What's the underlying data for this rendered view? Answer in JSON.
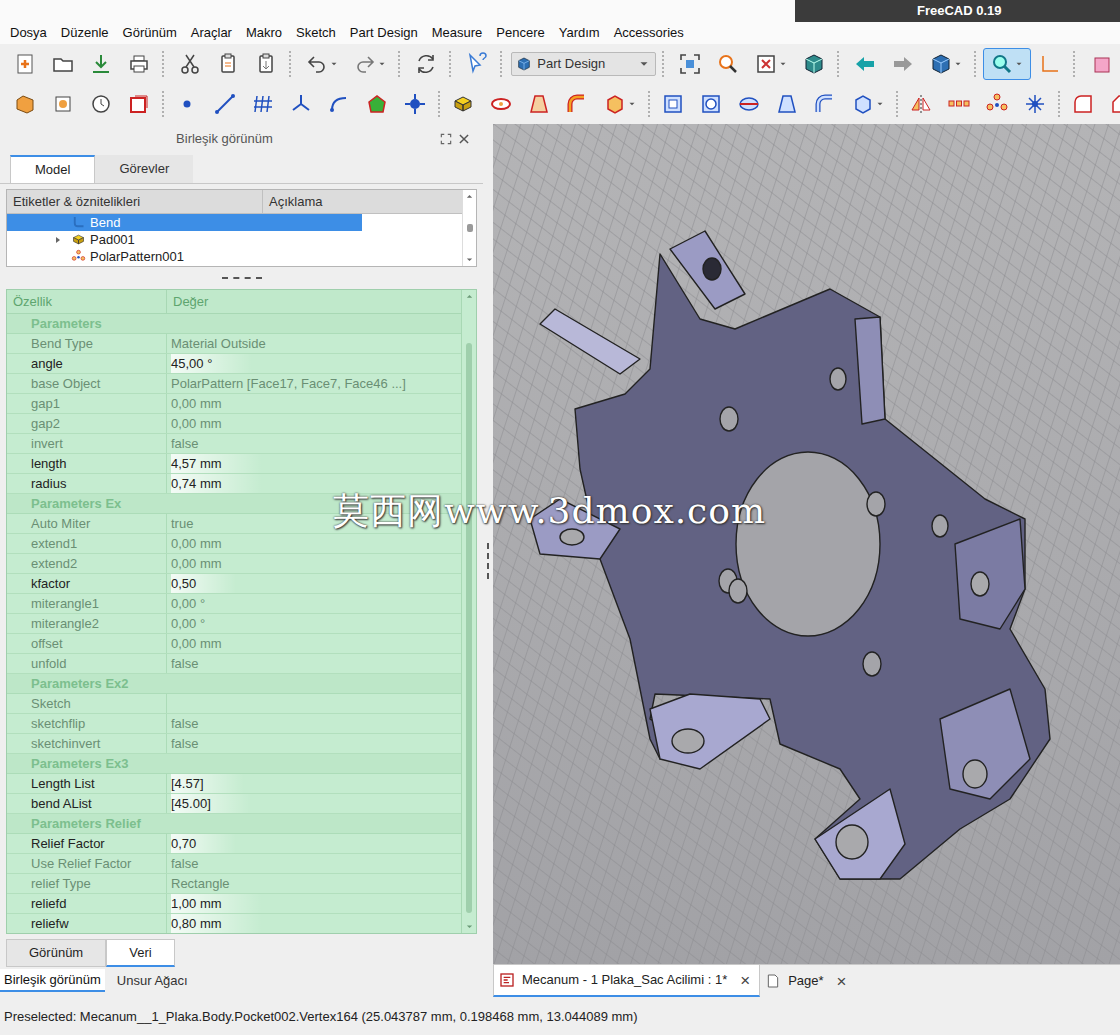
{
  "window": {
    "title": "FreeCAD 0.19"
  },
  "menu": [
    "Dosya",
    "Düzenle",
    "Görünüm",
    "Araçlar",
    "Makro",
    "Sketch",
    "Part Design",
    "Measure",
    "Pencere",
    "Yardım",
    "Accessories"
  ],
  "workbench": "Part Design",
  "combo_view": {
    "title": "Birleşik görünüm",
    "tabs": [
      {
        "label": "Model",
        "selected": true
      },
      {
        "label": "Görevler",
        "selected": false
      }
    ]
  },
  "tree": {
    "columns": [
      "Etiketler & öznitelikleri",
      "Açıklama"
    ],
    "items": [
      {
        "label": "Bend",
        "kind": "bend",
        "selected": true,
        "expandable": false
      },
      {
        "label": "Pad001",
        "kind": "pad",
        "selected": false,
        "expandable": true
      },
      {
        "label": "PolarPattern001",
        "kind": "pattern",
        "selected": false,
        "expandable": false
      }
    ]
  },
  "properties": {
    "columns": [
      "Özellik",
      "Değer"
    ],
    "groups": [
      {
        "title": "Parameters",
        "rows": [
          {
            "name": "Bend Type",
            "value": "Material Outside",
            "highlighted": false
          },
          {
            "name": "angle",
            "value": "45,00 °",
            "highlighted": true
          },
          {
            "name": "base Object",
            "value": "PolarPattern [Face17, Face7, Face46 ...]",
            "highlighted": false
          },
          {
            "name": "gap1",
            "value": "0,00 mm",
            "highlighted": false
          },
          {
            "name": "gap2",
            "value": "0,00 mm",
            "highlighted": false
          },
          {
            "name": "invert",
            "value": "false",
            "highlighted": false
          },
          {
            "name": "length",
            "value": "4,57 mm",
            "highlighted": true
          },
          {
            "name": "radius",
            "value": "0,74 mm",
            "highlighted": true
          }
        ]
      },
      {
        "title": "Parameters Ex",
        "rows": [
          {
            "name": "Auto Miter",
            "value": "true",
            "highlighted": false
          },
          {
            "name": "extend1",
            "value": "0,00 mm",
            "highlighted": false
          },
          {
            "name": "extend2",
            "value": "0,00 mm",
            "highlighted": false
          },
          {
            "name": "kfactor",
            "value": "0,50",
            "highlighted": true
          },
          {
            "name": "miterangle1",
            "value": "0,00 °",
            "highlighted": false
          },
          {
            "name": "miterangle2",
            "value": "0,00 °",
            "highlighted": false
          },
          {
            "name": "offset",
            "value": "0,00 mm",
            "highlighted": false
          },
          {
            "name": "unfold",
            "value": "false",
            "highlighted": false
          }
        ]
      },
      {
        "title": "Parameters Ex2",
        "rows": [
          {
            "name": "Sketch",
            "value": "",
            "highlighted": false
          },
          {
            "name": "sketchflip",
            "value": "false",
            "highlighted": false
          },
          {
            "name": "sketchinvert",
            "value": "false",
            "highlighted": false
          }
        ]
      },
      {
        "title": "Parameters Ex3",
        "rows": [
          {
            "name": "Length List",
            "value": "[4.57]",
            "highlighted": true
          },
          {
            "name": "bend AList",
            "value": "[45.00]",
            "highlighted": true
          }
        ]
      },
      {
        "title": "Parameters Relief",
        "rows": [
          {
            "name": "Relief Factor",
            "value": "0,70",
            "highlighted": true
          },
          {
            "name": "Use Relief Factor",
            "value": "false",
            "highlighted": false
          },
          {
            "name": "relief Type",
            "value": "Rectangle",
            "highlighted": false
          },
          {
            "name": "reliefd",
            "value": "1,00 mm",
            "highlighted": true
          },
          {
            "name": "reliefw",
            "value": "0,80 mm",
            "highlighted": true
          }
        ]
      }
    ]
  },
  "property_tabs": [
    {
      "label": "Görünüm",
      "selected": false
    },
    {
      "label": "Veri",
      "selected": true
    }
  ],
  "combo_tabs": [
    {
      "label": "Birleşik görünüm",
      "selected": true
    },
    {
      "label": "Unsur Ağacı",
      "selected": false
    }
  ],
  "watermark": "莫西网www.3dmox.com",
  "documents": [
    {
      "label": "Mecanum - 1 Plaka_Sac Acilimi : 1*",
      "kind": "model",
      "selected": true,
      "close": "×"
    },
    {
      "label": "Page*",
      "kind": "page",
      "selected": false,
      "close": "×"
    }
  ],
  "status_bar": "Preselected: Mecanum__1_Plaka.Body.Pocket002.Vertex164 (25.043787 mm, 0.198468 mm, 13.044089 mm)"
}
